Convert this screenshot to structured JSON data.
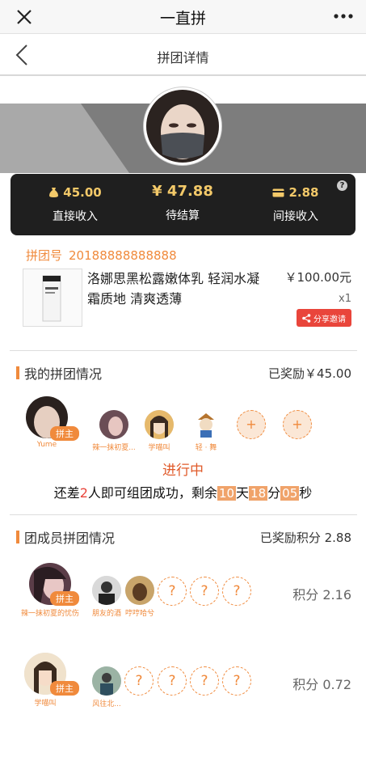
{
  "titlebar": {
    "title": "一直拼"
  },
  "navbar": {
    "title": "拼团详情"
  },
  "earnings": {
    "direct_value": "45.00",
    "direct_label": "直接收入",
    "pending_value": "¥ 47.88",
    "pending_label": "待结算",
    "indirect_value": "2.88",
    "indirect_label": "间接收入",
    "help": "?"
  },
  "order": {
    "label": "拼团号",
    "number": "20188888888888",
    "product_name": "洛娜思黑松露嫩体乳 轻润水凝霜质地  清爽透薄",
    "price": "￥100.00元",
    "qty": "x1",
    "share_label": "分享邀请"
  },
  "my_group": {
    "title": "我的拼团情况",
    "reward": "已奖励￥45.00",
    "owner_badge": "拼主",
    "members": [
      "Yume",
      "辣一抹初夏...",
      "学喵叫",
      "轻 · 舞"
    ],
    "empty_slot": "+",
    "status": "进行中",
    "countdown": {
      "prefix": "还差",
      "count": "2",
      "middle": "人即可组团成功，剩余",
      "days": "10",
      "days_unit": "天",
      "hours": "18",
      "hours_unit": "分",
      "seconds": "05",
      "seconds_unit": "秒"
    }
  },
  "members_section": {
    "title": "团成员拼团情况",
    "reward": "已奖励积分 2.88",
    "rows": [
      {
        "owner_name": "辣一抹初夏的忧伤",
        "badge": "拼主",
        "friends": [
          "朋友的酒",
          "哼哼哈兮"
        ],
        "slot": "?",
        "score": "积分 2.16"
      },
      {
        "owner_name": "学喵叫",
        "badge": "拼主",
        "friends": [
          "风往北..."
        ],
        "slot": "?",
        "score": "积分 0.72"
      }
    ]
  },
  "colors": {
    "accent": "#f08a3c",
    "card": "#1f1f1f",
    "gold": "#f3c969",
    "share": "#e9453b"
  }
}
